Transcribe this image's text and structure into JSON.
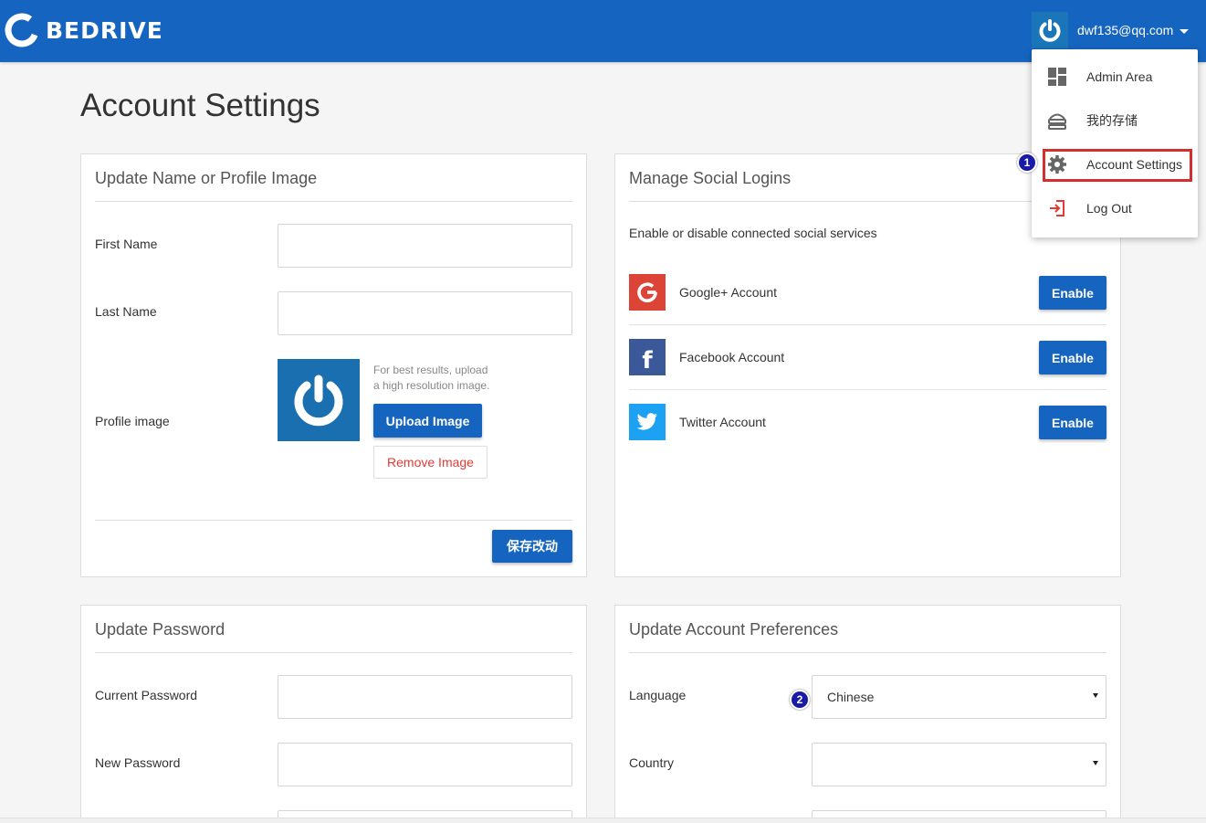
{
  "header": {
    "brand": "BEDRIVE",
    "user_email": "dwf135@qq.com"
  },
  "colors": {
    "primary": "#1565c0",
    "danger": "#e53935",
    "highlight": "#d32f2f",
    "google": "#db4437",
    "facebook": "#3b5998",
    "twitter": "#1da1f2"
  },
  "page": {
    "title": "Account Settings"
  },
  "profile_panel": {
    "title": "Update Name or Profile Image",
    "first_name_label": "First Name",
    "last_name_label": "Last Name",
    "profile_image_label": "Profile image",
    "hint_line1": "For best results, upload",
    "hint_line2": "a high resolution image.",
    "upload_button": "Upload Image",
    "remove_button": "Remove Image",
    "save_button": "保存改动"
  },
  "social_panel": {
    "title": "Manage Social Logins",
    "description": "Enable or disable connected social services",
    "services": [
      {
        "label": "Google+ Account",
        "icon": "google-icon",
        "button": "Enable"
      },
      {
        "label": "Facebook Account",
        "icon": "facebook-icon",
        "button": "Enable"
      },
      {
        "label": "Twitter Account",
        "icon": "twitter-icon",
        "button": "Enable"
      }
    ]
  },
  "password_panel": {
    "title": "Update Password",
    "current_label": "Current Password",
    "new_label": "New Password"
  },
  "preferences_panel": {
    "title": "Update Account Preferences",
    "language_label": "Language",
    "language_value": "Chinese",
    "country_label": "Country",
    "country_value": ""
  },
  "user_dropdown": {
    "items": [
      {
        "label": "Admin Area",
        "icon": "dashboard-icon"
      },
      {
        "label": "我的存储",
        "icon": "storage-icon"
      },
      {
        "label": "Account Settings",
        "icon": "gear-icon"
      },
      {
        "label": "Log Out",
        "icon": "logout-icon"
      }
    ]
  },
  "annotations": {
    "step1": "1",
    "step2": "2"
  }
}
